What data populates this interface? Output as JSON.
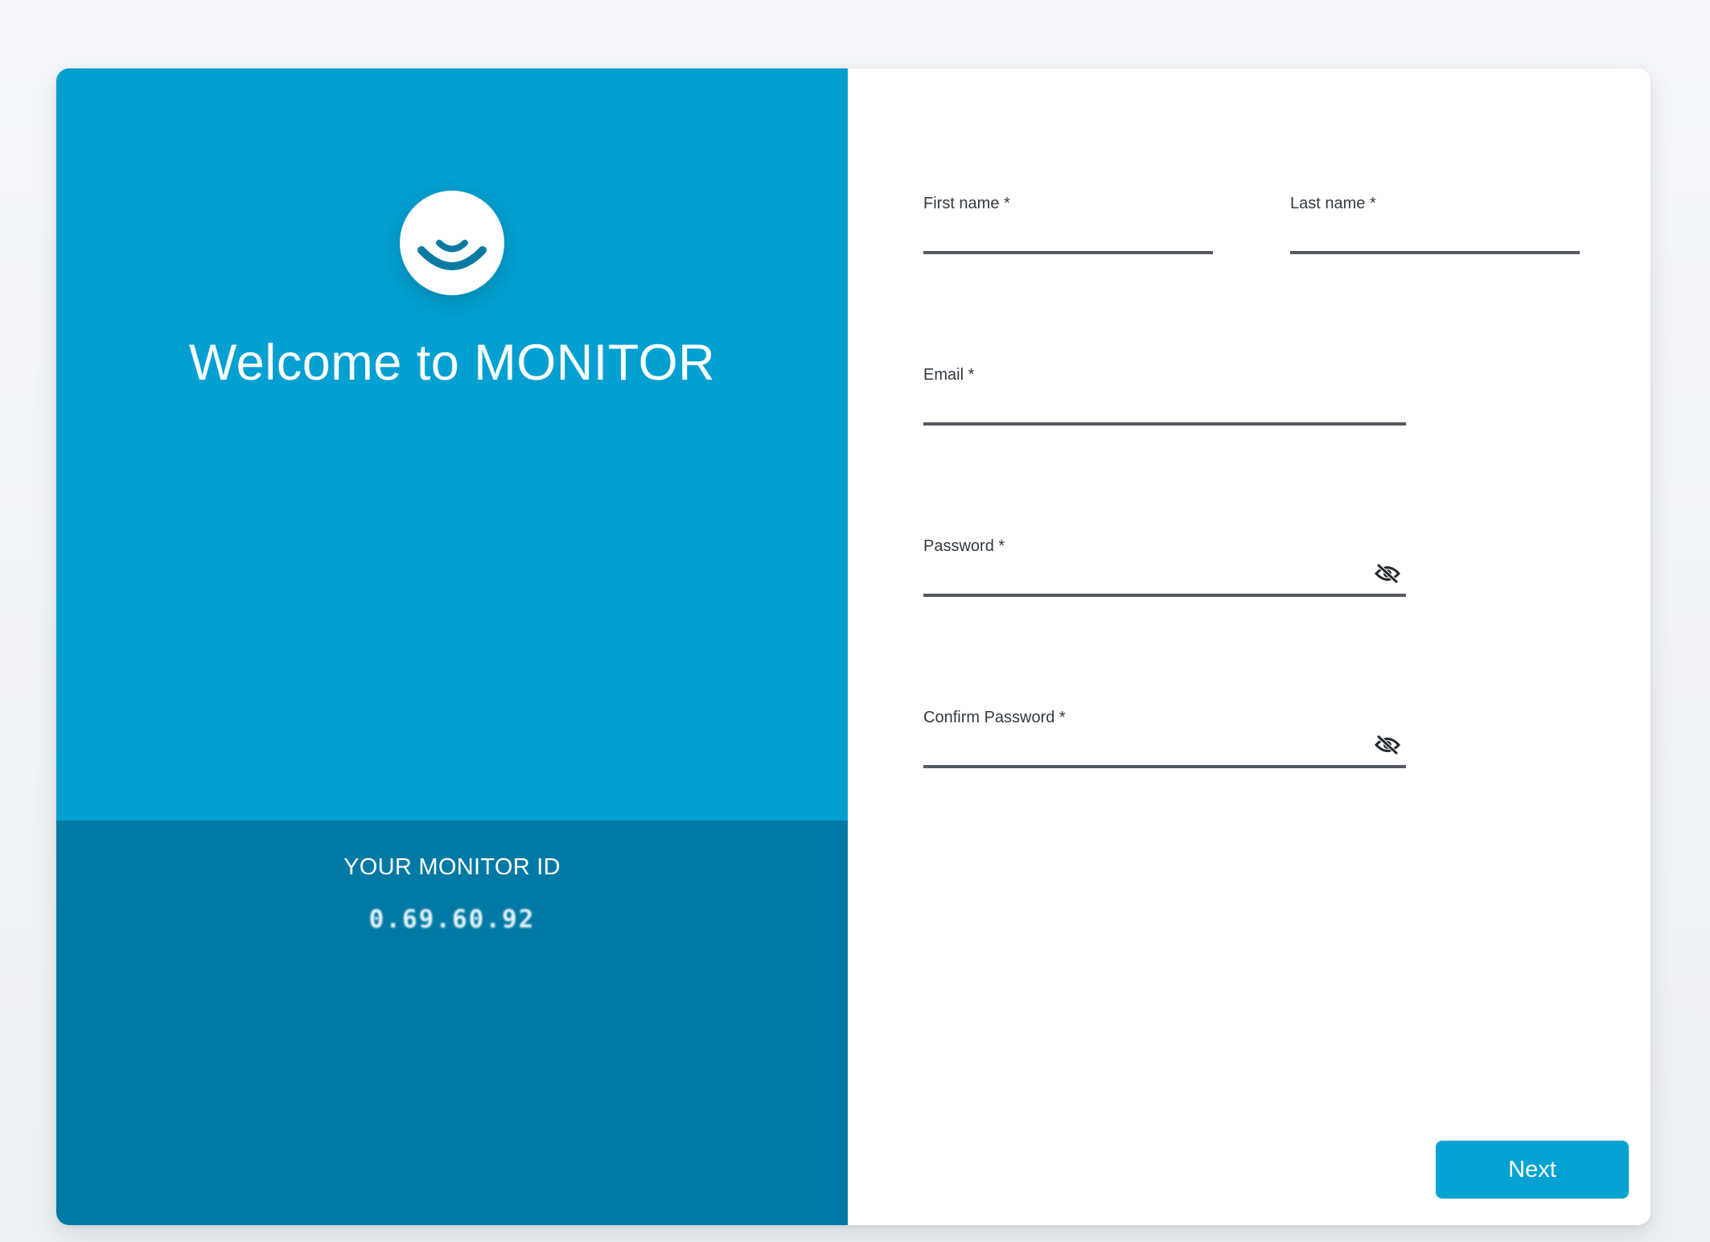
{
  "brand": {
    "welcome_title": "Welcome to MONITOR",
    "logo_icon": "smile-logo-icon",
    "primary_color": "#03a0d1",
    "secondary_color": "#0079a4"
  },
  "monitor_id": {
    "label": "YOUR MONITOR ID",
    "value": "0.69.60.92"
  },
  "form": {
    "first_name": {
      "label": "First name *",
      "value": ""
    },
    "last_name": {
      "label": "Last name *",
      "value": ""
    },
    "email": {
      "label": "Email *",
      "value": ""
    },
    "password": {
      "label": "Password *",
      "value": "",
      "toggle_icon": "eye-off-icon"
    },
    "confirm_password": {
      "label": "Confirm Password *",
      "value": "",
      "toggle_icon": "eye-off-icon"
    }
  },
  "actions": {
    "next_label": "Next"
  }
}
